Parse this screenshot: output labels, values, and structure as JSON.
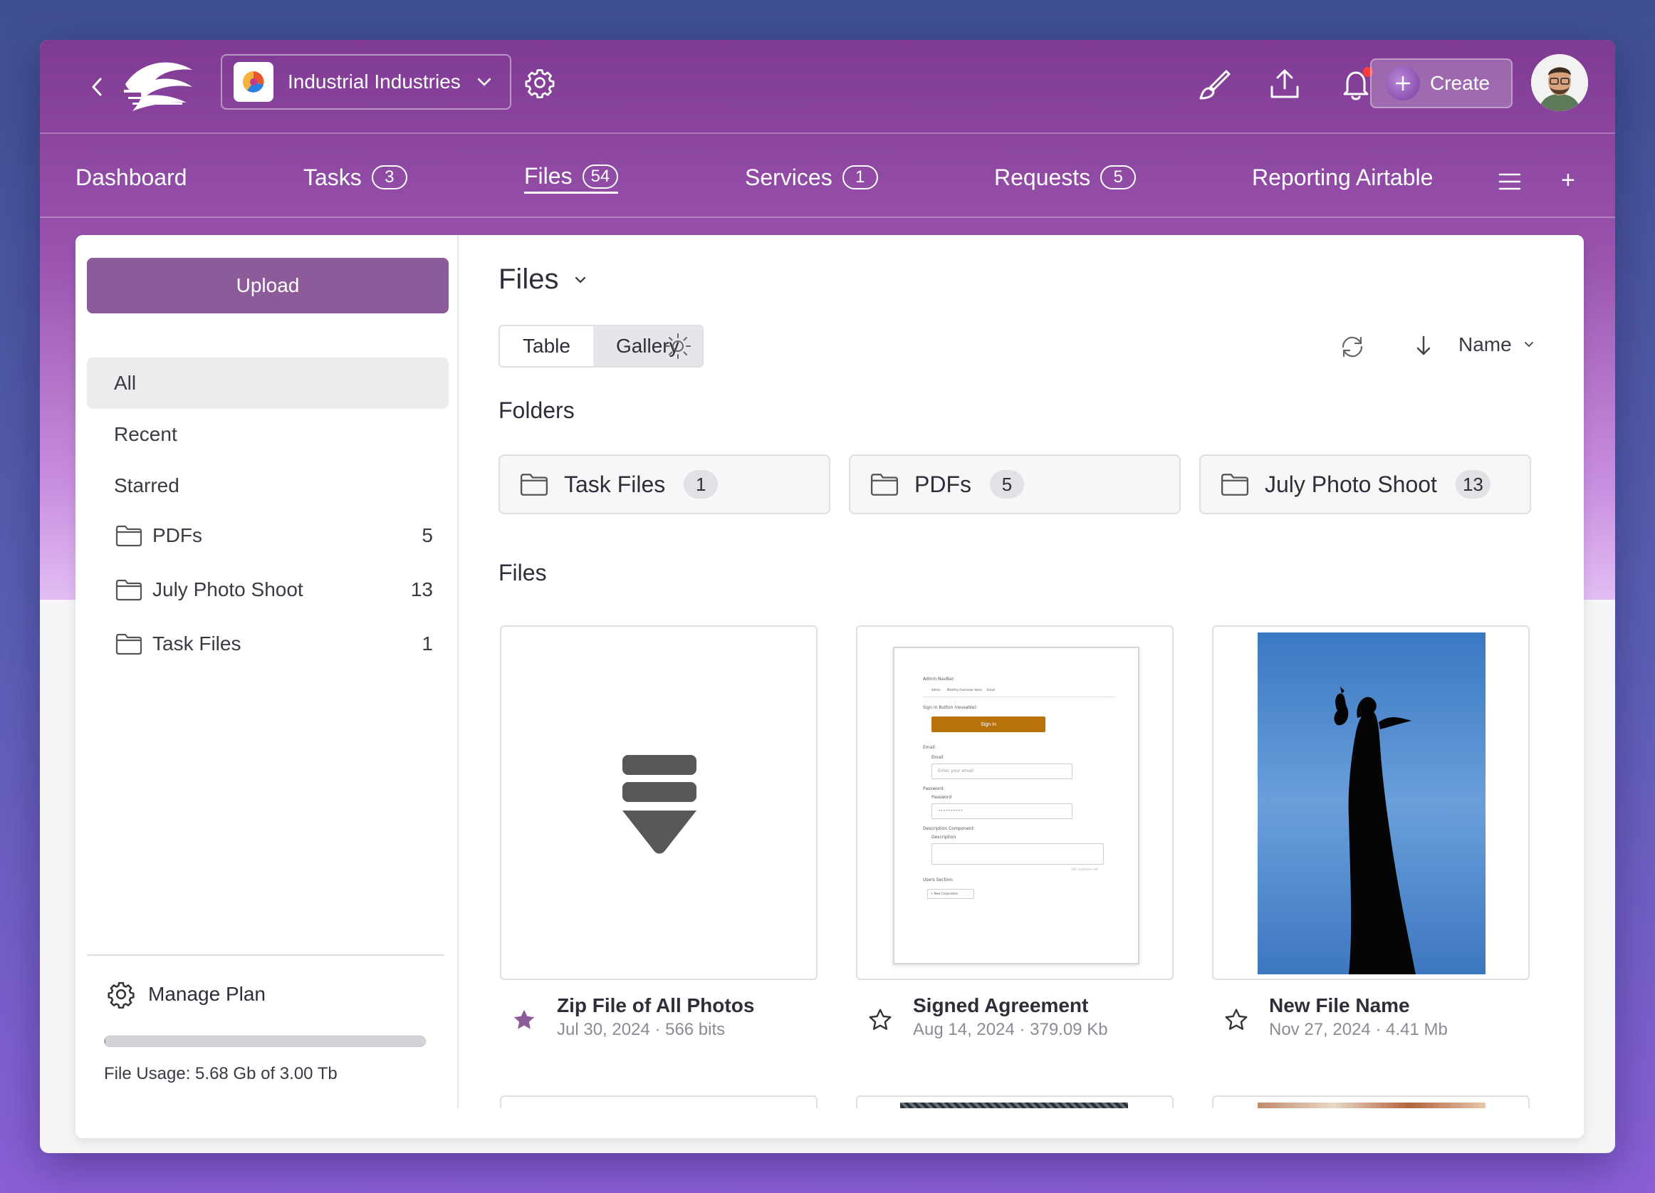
{
  "workspace": {
    "name": "Industrial Industries"
  },
  "topbar": {
    "create_label": "Create"
  },
  "nav": {
    "items": [
      {
        "label": "Dashboard",
        "count": null
      },
      {
        "label": "Tasks",
        "count": "3"
      },
      {
        "label": "Files",
        "count": "54",
        "active": true
      },
      {
        "label": "Services",
        "count": "1"
      },
      {
        "label": "Requests",
        "count": "5"
      },
      {
        "label": "Reporting Airtable",
        "count": null
      }
    ],
    "plus": "+"
  },
  "sidebar": {
    "upload_label": "Upload",
    "filters": [
      "All",
      "Recent",
      "Starred"
    ],
    "folders": [
      {
        "name": "PDFs",
        "count": "5"
      },
      {
        "name": "July Photo Shoot",
        "count": "13"
      },
      {
        "name": "Task Files",
        "count": "1"
      }
    ],
    "manage_label": "Manage Plan",
    "usage_text": "File Usage: 5.68 Gb of 3.00 Tb",
    "usage_fraction": 0.0019
  },
  "main": {
    "title": "Files",
    "views": [
      "Table",
      "Gallery"
    ],
    "sort_label": "Name",
    "folders_heading": "Folders",
    "files_heading": "Files",
    "folders": [
      {
        "name": "Task Files",
        "count": "1"
      },
      {
        "name": "PDFs",
        "count": "5"
      },
      {
        "name": "July Photo Shoot",
        "count": "13"
      }
    ],
    "files": [
      {
        "name": "Zip File of All Photos",
        "sub": "Jul 30, 2024 · 566 bits",
        "starred": true
      },
      {
        "name": "Signed Agreement",
        "sub": "Aug 14, 2024 · 379.09 Kb",
        "starred": false
      },
      {
        "name": "New File Name",
        "sub": "Nov 27, 2024 · 4.41 Mb",
        "starred": false
      }
    ]
  },
  "doc_preview": {
    "nav_label": "Admin NavBar:",
    "tabs": [
      "Admin",
      "Monthly Overview",
      "Users",
      "Email"
    ],
    "signin_section": "Sign in Button (reusable):",
    "signin_button": "Sign In",
    "email_section": "Email:",
    "email_label": "Email",
    "email_placeholder": "Enter your email",
    "password_section": "Password:",
    "password_label": "Password",
    "password_value": "••••••••••",
    "desc_section": "Description Component:",
    "desc_label": "Description",
    "desc_counter": "100 characters left",
    "users_section": "Users Section:",
    "users_button": "+ New Corporation"
  },
  "colors": {
    "accent": "#8c5b9a",
    "star_filled": "#8c5b9a",
    "signin": "#b8720a",
    "notif": "#ff3b3b"
  },
  "icons": [
    "back-chevron-icon",
    "brush-icon",
    "upload-icon",
    "bell-icon",
    "gear-icon",
    "folder-icon",
    "star-icon",
    "refresh-icon",
    "sun-icon",
    "sort-arrow-icon",
    "hamburger-icon",
    "download-stack-icon"
  ]
}
